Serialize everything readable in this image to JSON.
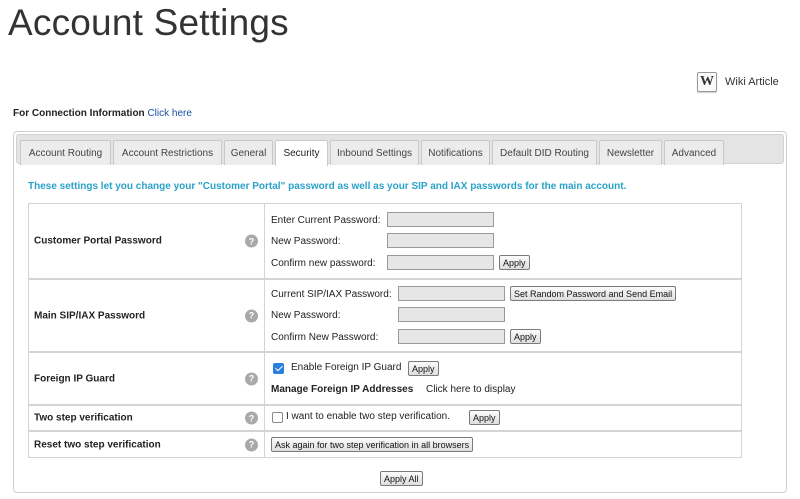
{
  "page": {
    "title": "Account Settings"
  },
  "wiki": {
    "icon": "wikipedia-icon",
    "icon_glyph": "W",
    "label": "Wiki Article"
  },
  "connection": {
    "label": "For Connection Information",
    "link": "Click here"
  },
  "tabs": [
    {
      "label": "Account Routing"
    },
    {
      "label": "Account Restrictions"
    },
    {
      "label": "General"
    },
    {
      "label": "Security",
      "active": true
    },
    {
      "label": "Inbound Settings"
    },
    {
      "label": "Notifications"
    },
    {
      "label": "Default DID Routing"
    },
    {
      "label": "Newsletter"
    },
    {
      "label": "Advanced"
    }
  ],
  "description": "These settings let you change your \"Customer Portal\" password as well as your SIP and IAX passwords for the main account.",
  "help_glyph": "?",
  "sections": {
    "portal": {
      "label": "Customer Portal Password",
      "current": "Enter Current Password:",
      "new": "New Password:",
      "confirm": "Confirm new password:",
      "apply": "Apply"
    },
    "sip": {
      "label": "Main SIP/IAX Password",
      "current": "Current SIP/IAX Password:",
      "random": "Set Random Password and Send Email",
      "new": "New Password:",
      "confirm": "Confirm New Password:",
      "apply": "Apply"
    },
    "foreign": {
      "label": "Foreign IP Guard",
      "enable": "Enable Foreign IP Guard",
      "enabled": true,
      "apply": "Apply",
      "manage_label": "Manage Foreign IP Addresses",
      "manage_link": "Click here to display"
    },
    "twostep": {
      "label": "Two step verification",
      "enable": "I want to enable two step verification.",
      "enabled": false,
      "apply": "Apply"
    },
    "reset": {
      "label": "Reset two step verification",
      "button": "Ask again for two step verification in all browsers"
    }
  },
  "apply_all": "Apply All",
  "colors": {
    "description": "#2aa2c8",
    "link": "#1a4fa0",
    "checkbox": "#2a7ee0"
  }
}
